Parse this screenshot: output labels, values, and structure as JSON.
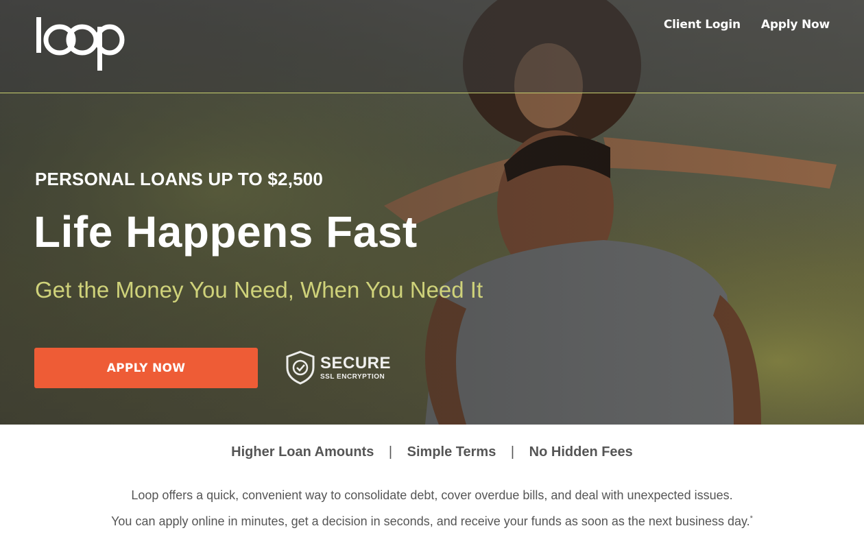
{
  "brand": {
    "logo_text": "loop"
  },
  "nav": {
    "client_login": "Client Login",
    "apply_now": "Apply Now"
  },
  "hero": {
    "eyebrow": "PERSONAL LOANS UP TO $2,500",
    "headline": "Life Happens Fast",
    "subline": "Get the Money You Need, When You Need It",
    "cta_label": "APPLY NOW",
    "badge_title": "SECURE",
    "badge_subtitle": "SSL ENCRYPTION",
    "image_description_icon": "family-photo"
  },
  "features": {
    "items": [
      "Higher Loan Amounts",
      "Simple Terms",
      "No Hidden Fees"
    ],
    "separator": "|"
  },
  "description": {
    "line1": "Loop offers a quick, convenient way to consolidate debt, cover overdue bills, and deal with unexpected issues.",
    "line2": "You can apply online in minutes, get a decision in seconds, and receive your funds as soon as the next business day.",
    "footnote_mark": "*"
  },
  "colors": {
    "cta": "#ee5c36",
    "accent_text": "#cfd27a",
    "rule": "#c9d06e",
    "body_text": "#555555"
  }
}
